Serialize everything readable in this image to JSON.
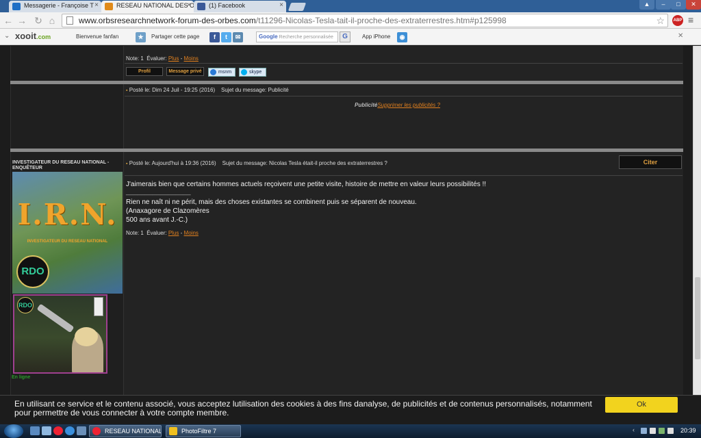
{
  "browser": {
    "tabs": [
      {
        "title": "Messagerie - Françoise T",
        "favicon": "outlook-icon"
      },
      {
        "title": "RESEAU NATIONAL DES O",
        "favicon": "xooit-icon",
        "active": true
      },
      {
        "title": "(1) Facebook",
        "favicon": "facebook-icon"
      }
    ],
    "url_host": "www.orbsresearchnetwork-forum-des-orbes.com",
    "url_path": "/t11296-Nicolas-Tesla-tait-il-proche-des-extraterrestres.htm#p125998",
    "abp_label": "ABP"
  },
  "xooit_bar": {
    "logo": "xooit",
    "logo_suffix": ".com",
    "welcome": "Bienvenue fanfan",
    "share": "Partager cette page",
    "search_placeholder": "Recherche personnalisée",
    "search_brand": "Google",
    "search_button": "G",
    "iphone": "App iPhone"
  },
  "post1": {
    "rating_label": "Note: 1",
    "evaluate": "Évaluer:",
    "plus": "Plus",
    "sep": "-",
    "minus": "Moins",
    "profile_btn": "Profil",
    "pm_btn": "Message privé",
    "msn_btn": "msnm",
    "skype_btn": "skype"
  },
  "ad_post": {
    "posted": "Posté le: Dim 24 Juil - 19:25 (2016)",
    "subject": "Sujet du message: Publicité",
    "ad_label": "Publicité",
    "remove_ads": "Supprimer les publicités ?"
  },
  "post2": {
    "author_title": "INVESTIGATEUR DU RESEAU NATIONAL - ENQUÊTEUR",
    "avatar_title": "I.R.N.",
    "avatar_subtitle": "INVESTIGATEUR DU RESEAU NATIONAL",
    "avatar_badge": "RDO",
    "posted": "Posté le: Aujourd'hui à 19:36 (2016)",
    "subject": "Sujet du message: Nicolas Tesla était-il proche des extraterrestres ?",
    "quote_btn": "Citer",
    "body": "J'aimerais bien que certains hommes actuels reçoivent une petite visite, histoire de mettre en valeur leurs possibilités !!",
    "signature_sep": "_________________",
    "signature_1": "Rien ne naît ni ne périt, mais des choses existantes se combinent puis se séparent de nouveau.",
    "signature_2": "(Anaxagore de Clazomères",
    "signature_3": "500 ans avant J.-C.)",
    "rating_label": "Note: 1",
    "evaluate": "Évaluer:",
    "plus": "Plus",
    "sep": "-",
    "minus": "Moins",
    "status": "En ligne"
  },
  "cookie_banner": {
    "text": "En utilisant ce service et le contenu associé, vous acceptez lutilisation des cookies à des fins danalyse, de publicités et de contenus personnalisés, notamment pour permettre de vous connecter à votre compte membre.",
    "ok": "Ok"
  },
  "taskbar": {
    "items": [
      {
        "label": "RESEAU NATIONAL ..."
      },
      {
        "label": "PhotoFiltre 7"
      }
    ],
    "clock": "20:39"
  },
  "colors": {
    "accent_orange": "#e1801f",
    "button_yellow": "#f2d31e",
    "online_green": "#2a9a2a",
    "page_bg": "#1c1c1c"
  }
}
